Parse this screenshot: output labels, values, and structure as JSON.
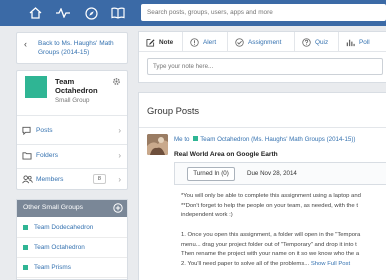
{
  "top_nav": {
    "icons": [
      "home-icon",
      "activity-pulse-icon",
      "compass-icon",
      "book-icon"
    ],
    "search_placeholder": "Search posts, groups, users, apps and more"
  },
  "back_link": {
    "label": "Back to Ms. Haughs' Math Groups (2014-15)"
  },
  "group": {
    "name": "Team Octahedron",
    "type": "Small Group",
    "color": "#2fb594",
    "menu": [
      {
        "label": "Posts",
        "icon": "speech-bubble-icon"
      },
      {
        "label": "Folders",
        "icon": "folder-icon"
      },
      {
        "label": "Members",
        "icon": "members-icon",
        "count": "8"
      }
    ]
  },
  "other_groups": {
    "title": "Other Small Groups",
    "items": [
      "Team Dodecahedron",
      "Team Octahedron",
      "Team Prisms"
    ]
  },
  "composer": {
    "tabs": [
      {
        "label": "Note",
        "icon": "pencil-icon",
        "active": true
      },
      {
        "label": "Alert",
        "icon": "alert-icon"
      },
      {
        "label": "Assignment",
        "icon": "assignment-check-icon"
      },
      {
        "label": "Quiz",
        "icon": "quiz-question-icon"
      },
      {
        "label": "Poll",
        "icon": "poll-bars-icon"
      }
    ],
    "placeholder": "Type your note here..."
  },
  "posts": {
    "heading": "Group Posts",
    "post": {
      "meta_prefix": "Me to",
      "meta_group": "Team Octahedron (Ms. Haughs' Math Groups (2014-15))",
      "title": "Real World Area on Google Earth",
      "turned_in": "Turned In (0)",
      "due": "Due Nov 28, 2014",
      "lines": [
        "*You will only be able to complete this assignment using a laptop and",
        "**Don't forget to help the people on your team, as needed, with the t",
        "independent work :)",
        "",
        "1. Once you open this assignment, a folder will open in the \"Tempora",
        "menu... drag your project folder out of \"Temporary\" and drop it into t",
        "Then rename the project with your name on it so we know who the a"
      ],
      "last_line": "2. You'll need paper to solve all of the problems...",
      "show_full": "Show Full Post"
    }
  }
}
